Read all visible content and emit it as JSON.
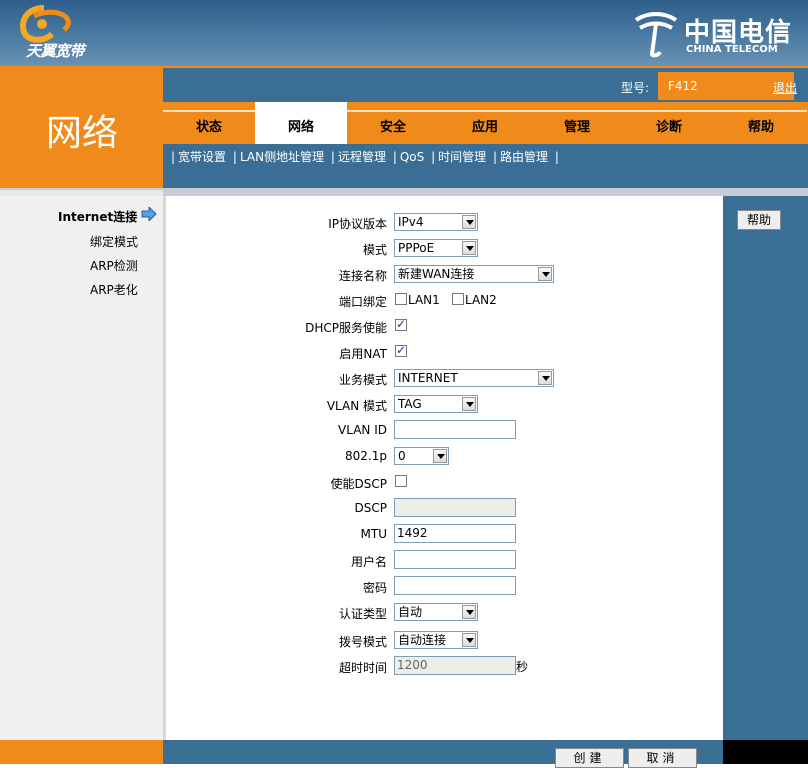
{
  "header": {
    "brand_left": "天翼宽带",
    "brand_right_cn": "中国电信",
    "brand_right_en": "CHINA TELECOM"
  },
  "section_title": "网络",
  "topbar": {
    "model_label": "型号:",
    "model_value": "F412",
    "logout": "退出"
  },
  "nav": {
    "tabs": [
      {
        "label": "状态"
      },
      {
        "label": "网络"
      },
      {
        "label": "安全"
      },
      {
        "label": "应用"
      },
      {
        "label": "管理"
      },
      {
        "label": "诊断"
      },
      {
        "label": "帮助"
      }
    ]
  },
  "subnav": {
    "items": [
      "宽带设置",
      "LAN侧地址管理",
      "远程管理",
      "QoS",
      "时间管理",
      "路由管理"
    ]
  },
  "leftmenu": {
    "active": "Internet连接",
    "items": [
      "绑定模式",
      "ARP检测",
      "ARP老化"
    ]
  },
  "help_button": "帮助",
  "form": {
    "ip_version": {
      "label": "IP协议版本",
      "value": "IPv4"
    },
    "mode": {
      "label": "模式",
      "value": "PPPoE"
    },
    "conn_name": {
      "label": "连接名称",
      "value": "新建WAN连接"
    },
    "port_bind": {
      "label": "端口绑定",
      "lan1": "LAN1",
      "lan2": "LAN2"
    },
    "dhcp": {
      "label": "DHCP服务使能"
    },
    "nat": {
      "label": "启用NAT"
    },
    "service_mode": {
      "label": "业务模式",
      "value": "INTERNET"
    },
    "vlan_mode": {
      "label": "VLAN 模式",
      "value": "TAG"
    },
    "vlan_id": {
      "label": "VLAN ID",
      "value": ""
    },
    "p8021": {
      "label": "802.1p",
      "value": "0"
    },
    "dscp_enable": {
      "label": "使能DSCP"
    },
    "dscp": {
      "label": "DSCP",
      "value": ""
    },
    "mtu": {
      "label": "MTU",
      "value": "1492"
    },
    "username": {
      "label": "用户名",
      "value": ""
    },
    "password": {
      "label": "密码",
      "value": ""
    },
    "auth_type": {
      "label": "认证类型",
      "value": "自动"
    },
    "dial_mode": {
      "label": "拨号模式",
      "value": "自动连接"
    },
    "timeout": {
      "label": "超时时间",
      "value": "1200",
      "unit": "秒"
    }
  },
  "footer": {
    "create": "创建",
    "cancel": "取消"
  }
}
